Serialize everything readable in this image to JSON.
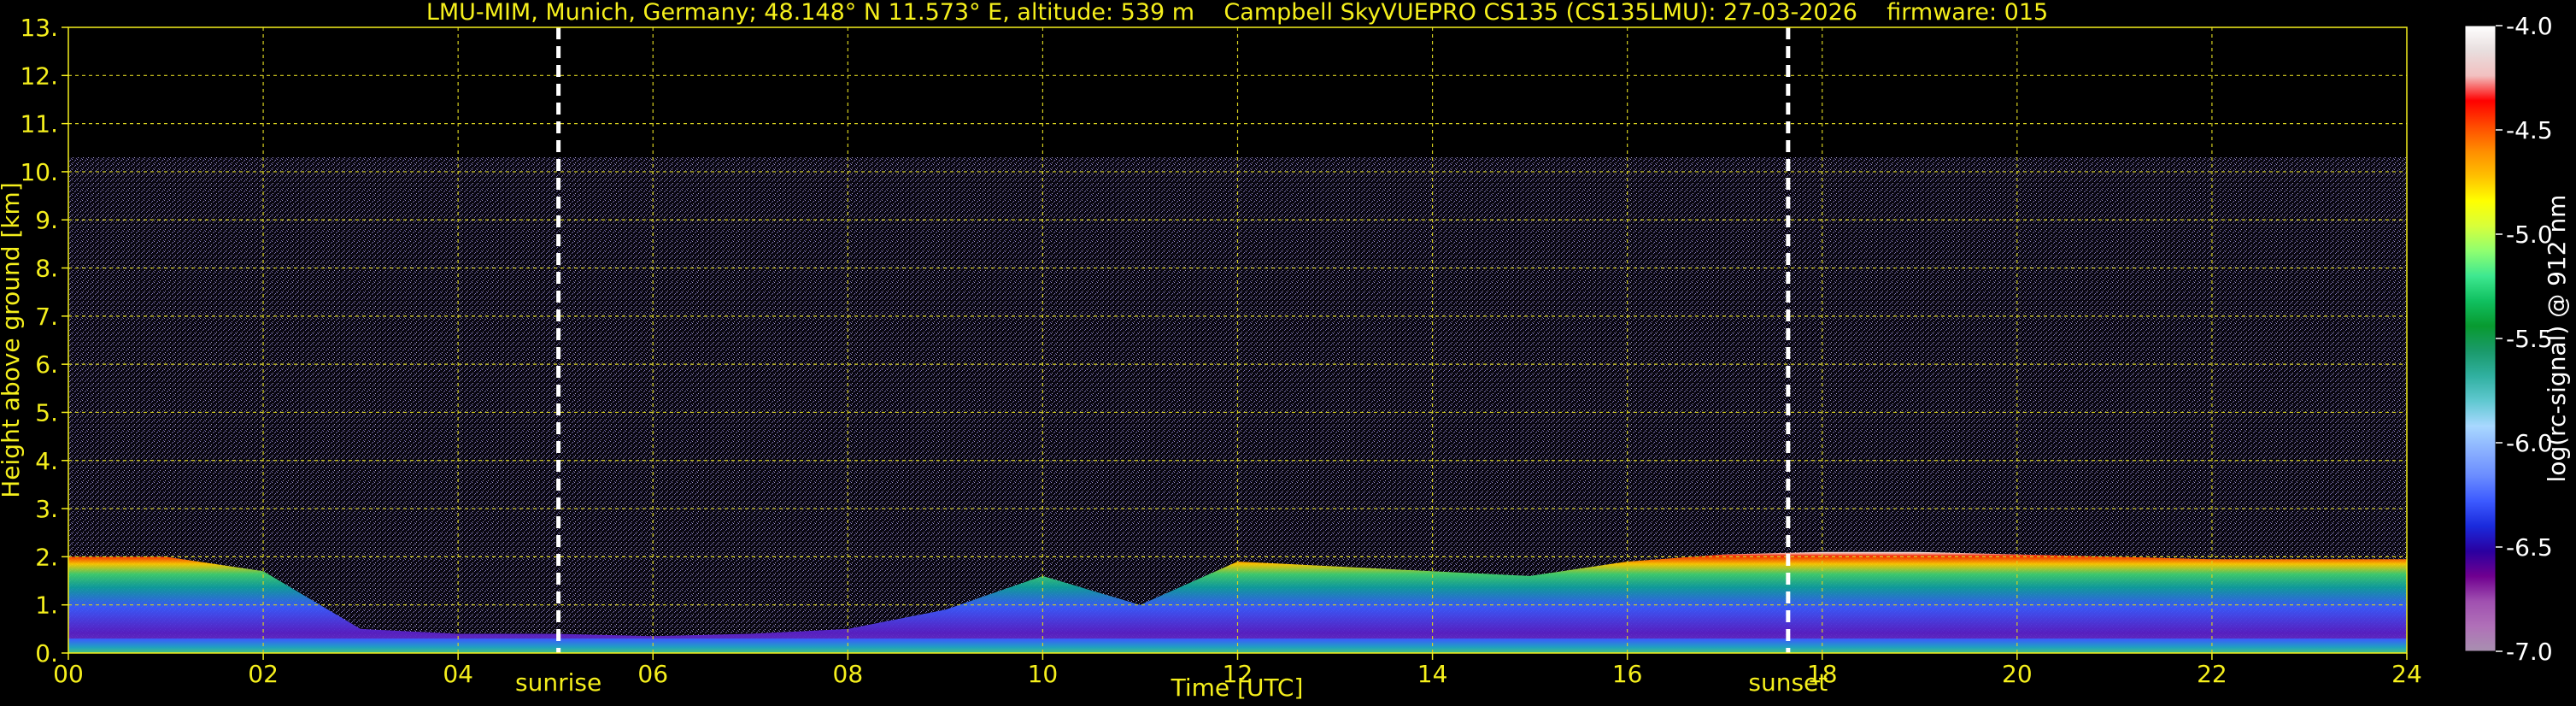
{
  "chart_data": {
    "type": "heatmap",
    "title": "LMU-MIM, Munich, Germany; 48.148° N 11.573° E, altitude: 539 m    Campbell SkyVUEPRO CS135 (CS135LMU): 27-03-2026    firmware: 015",
    "xlabel": "Time [UTC]",
    "ylabel": "Height above ground [km]",
    "xlim": [
      0,
      24
    ],
    "ylim": [
      0,
      13
    ],
    "x_ticks": [
      "00",
      "02",
      "04",
      "06",
      "08",
      "10",
      "12",
      "14",
      "16",
      "18",
      "20",
      "22",
      "24"
    ],
    "y_ticks": [
      "0.",
      "1.",
      "2.",
      "3.",
      "4.",
      "5.",
      "6.",
      "7.",
      "8.",
      "9.",
      "10.",
      "11.",
      "12.",
      "13."
    ],
    "grid": true,
    "events": [
      {
        "label": "sunrise",
        "time": 5.03
      },
      {
        "label": "sunset",
        "time": 17.65
      }
    ],
    "colorbar": {
      "label": "log(rc-signal) @ 912 nm",
      "range": [
        -7.0,
        -4.0
      ],
      "ticks": [
        "-4.0",
        "-4.5",
        "-5.0",
        "-5.5",
        "-6.0",
        "-6.5",
        "-7.0"
      ],
      "colors": [
        "#ffffff",
        "#e8dede",
        "#f2c0c0",
        "#ff0000",
        "#ff4a00",
        "#ff8c00",
        "#ffbf00",
        "#ffff00",
        "#d8ff3a",
        "#90ff70",
        "#3ee890",
        "#10c060",
        "#089a30",
        "#1a9a6a",
        "#30b0a0",
        "#60c8d0",
        "#a8d8ff",
        "#8ab0ff",
        "#6a8cff",
        "#3c5aff",
        "#1a2adc",
        "#2a00a0",
        "#700090",
        "#a050b0",
        "#b070b8",
        "#a890b0"
      ]
    },
    "layers": [
      {
        "name": "boundary_layer_top",
        "x": [
          0,
          1,
          2,
          3,
          4,
          5,
          6,
          7,
          8,
          9,
          10,
          11,
          12,
          13,
          14,
          15,
          16,
          17,
          18,
          19,
          20,
          21,
          22,
          23,
          24
        ],
        "y": [
          2.0,
          2.0,
          1.7,
          0.5,
          0.4,
          0.4,
          0.35,
          0.4,
          0.5,
          0.9,
          1.6,
          1.0,
          1.9,
          1.8,
          1.7,
          1.6,
          1.9,
          2.05,
          2.1,
          2.1,
          2.05,
          2.0,
          1.95,
          1.95,
          1.95
        ]
      },
      {
        "name": "noise_region_top",
        "x": [
          0,
          24
        ],
        "y": [
          10.3,
          10.3
        ]
      }
    ]
  }
}
